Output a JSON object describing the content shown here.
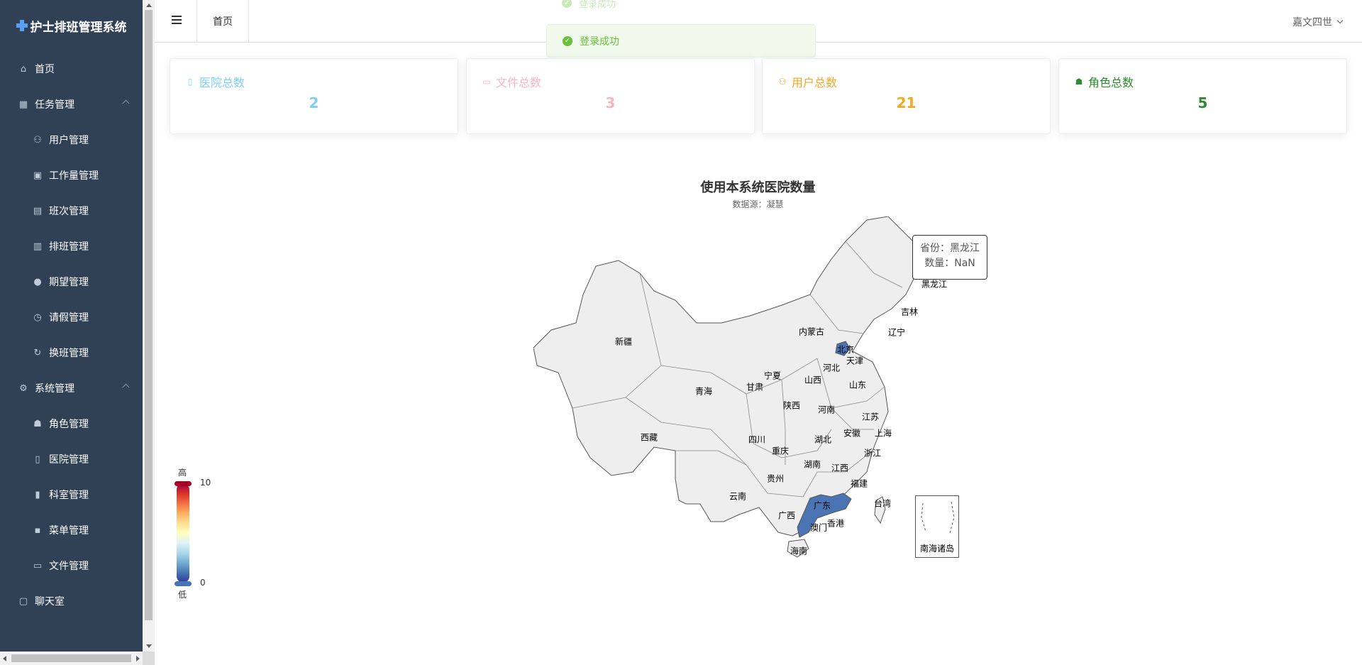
{
  "app": {
    "title": "护士排班管理系统"
  },
  "sidebar": {
    "items": [
      {
        "label": "首页",
        "icon": "home-icon"
      },
      {
        "label": "任务管理",
        "icon": "grid-icon"
      },
      {
        "label": "用户管理",
        "icon": "user-icon"
      },
      {
        "label": "工作量管理",
        "icon": "clipboard-check-icon"
      },
      {
        "label": "班次管理",
        "icon": "clipboard-icon"
      },
      {
        "label": "排班管理",
        "icon": "calendar-icon"
      },
      {
        "label": "期望管理",
        "icon": "balloon-icon"
      },
      {
        "label": "请假管理",
        "icon": "clock-icon"
      },
      {
        "label": "换班管理",
        "icon": "refresh-icon"
      },
      {
        "label": "系统管理",
        "icon": "gear-icon"
      },
      {
        "label": "角色管理",
        "icon": "user-solid-icon"
      },
      {
        "label": "医院管理",
        "icon": "building-icon"
      },
      {
        "label": "科室管理",
        "icon": "office-icon"
      },
      {
        "label": "菜单管理",
        "icon": "menu-grid-icon"
      },
      {
        "label": "文件管理",
        "icon": "suitcase-icon"
      },
      {
        "label": "聊天室",
        "icon": "chat-icon"
      }
    ]
  },
  "header": {
    "tab": "首页",
    "user": "嘉文四世"
  },
  "toast": {
    "message": "登录成功",
    "ghost_message": "登录成功"
  },
  "cards": [
    {
      "label": "医院总数",
      "value": "2",
      "color": "#7ecef4"
    },
    {
      "label": "文件总数",
      "value": "3",
      "color": "#f9b4c4"
    },
    {
      "label": "用户总数",
      "value": "21",
      "color": "#f5a623"
    },
    {
      "label": "角色总数",
      "value": "5",
      "color": "#2e8b2e"
    }
  ],
  "chart_data": {
    "type": "map",
    "title": "使用本系统医院数量",
    "subtitle": "数据源：凝慧",
    "visual_map": {
      "max": 10,
      "min": 0,
      "high_label": "高",
      "low_label": "低"
    },
    "highlighted": [
      "北京",
      "广东"
    ],
    "highlight_color": "#4a74b4",
    "regions": [
      "黑龙江",
      "吉林",
      "辽宁",
      "内蒙古",
      "北京",
      "天津",
      "河北",
      "新疆",
      "宁夏",
      "甘肃",
      "山西",
      "山东",
      "青海",
      "陕西",
      "河南",
      "江苏",
      "安徽",
      "上海",
      "西藏",
      "四川",
      "湖北",
      "重庆",
      "浙江",
      "湖南",
      "江西",
      "贵州",
      "福建",
      "云南",
      "广西",
      "广东",
      "台湾",
      "澳门",
      "香港",
      "海南",
      "南海诸岛"
    ],
    "tooltip": {
      "line1": "省份：黑龙江",
      "line2": "数量：NaN"
    }
  }
}
